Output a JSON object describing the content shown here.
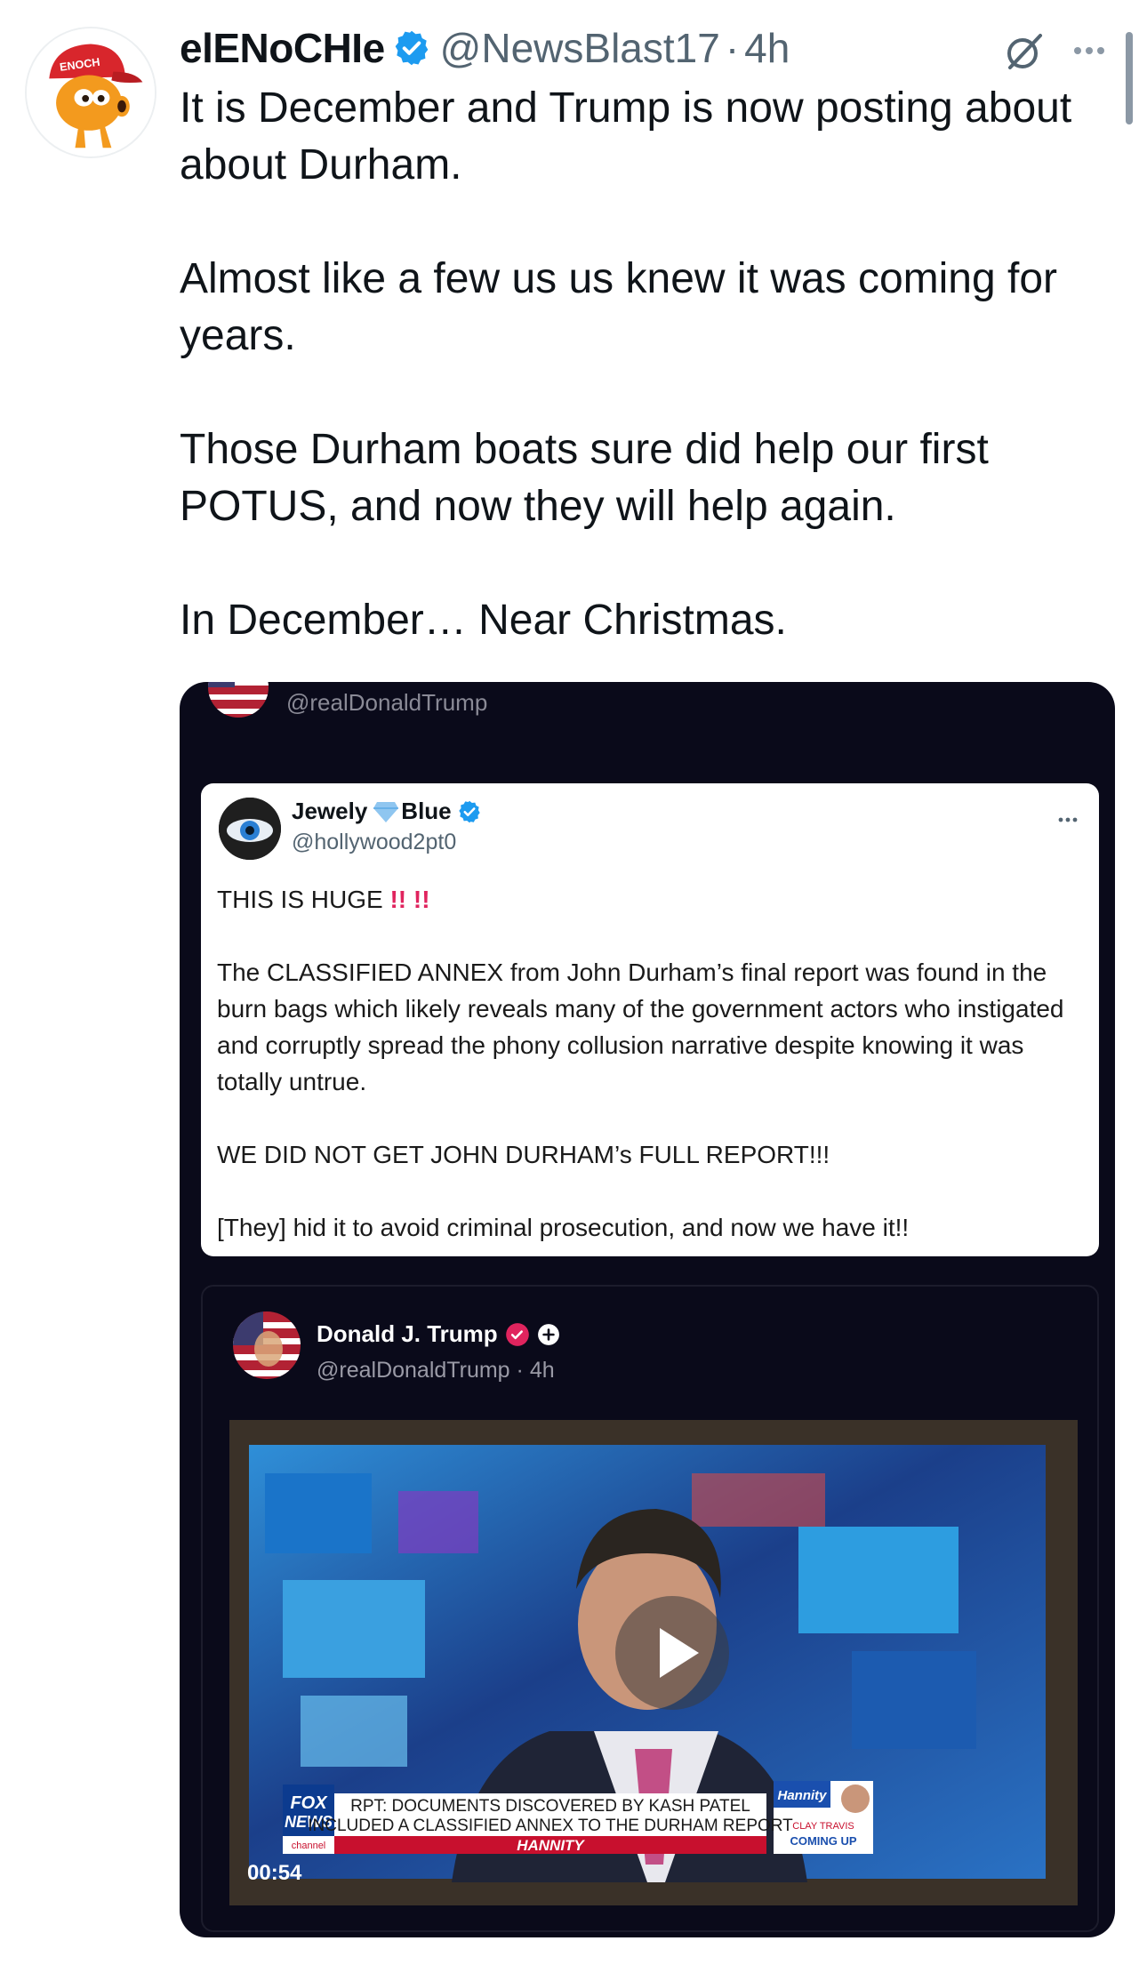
{
  "tweet": {
    "display_name": "elENoCHIe",
    "handle": "@NewsBlast17",
    "separator": "·",
    "time": "4h",
    "avatar_cap_text": "ENOCH",
    "text_paragraphs": [
      "It is December and Trump is now posting about about Durham.",
      "Almost like a few us us knew it was coming for years.",
      "Those Durham boats sure did help our first POTUS, and now they will help again.",
      "In December… Near Christmas."
    ],
    "icons": {
      "verified": "verified-badge-icon",
      "grok": "grok-icon",
      "more": "more-icon"
    }
  },
  "media": {
    "top_handle": "@realDonaldTrump",
    "quote": {
      "name_part1": "Jewely",
      "name_part2": "Blue",
      "handle": "@hollywood2pt0",
      "headline": "THIS IS HUGE",
      "headline_bangs": "!! !!",
      "paragraphs": [
        "The CLASSIFIED ANNEX from John Durham’s final report was found in the burn bags which likely reveals many of the government actors who instigated and corruptly spread the phony collusion narrative despite knowing it was totally untrue.",
        "WE DID NOT GET JOHN DURHAM’s FULL REPORT!!!",
        "[They] hid it to avoid criminal prosecution, and now we have it!!"
      ]
    },
    "trump_post": {
      "name": "Donald J. Trump",
      "handle": "@realDonaldTrump",
      "separator": "·",
      "time": "4h"
    },
    "video": {
      "duration": "00:54",
      "chyron_line1": "RPT: DOCUMENTS DISCOVERED BY KASH PATEL",
      "chyron_line2": "INCLUDED A CLASSIFIED ANNEX TO THE DURHAM REPORT",
      "show_name": "HANNITY",
      "network_line1": "FOX",
      "network_line2": "NEWS",
      "network_line3": "channel",
      "promo_show": "Hannity",
      "promo_line1": "CLAY TRAVIS",
      "promo_line2": "COMING UP"
    }
  },
  "colors": {
    "text": "#0f1419",
    "secondary": "#536471",
    "verified_blue": "#1d9bf0",
    "media_bg": "#0a0a1a",
    "truth_badge": "#e0245e",
    "fox_red": "#c8102e",
    "fox_blue": "#0c3b8f"
  }
}
